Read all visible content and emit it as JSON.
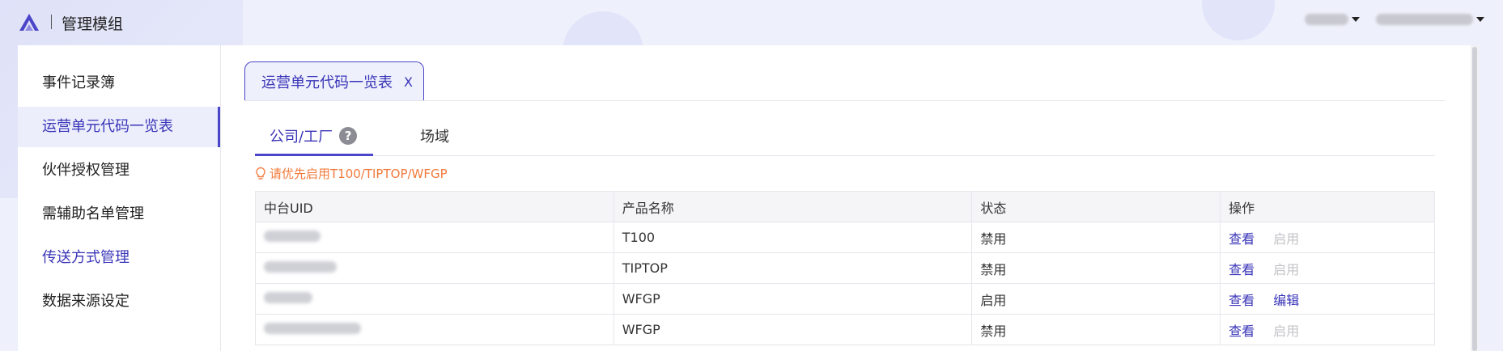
{
  "app": {
    "title": "管理模组"
  },
  "header": {
    "users": [
      {
        "label": "",
        "blur_width": 54
      },
      {
        "label": "",
        "blur_width": 120
      }
    ]
  },
  "sidebar": {
    "items": [
      {
        "label": "事件记录簿",
        "active": false
      },
      {
        "label": "运营单元代码一览表",
        "active": true
      },
      {
        "label": "伙伴授权管理",
        "active": false
      },
      {
        "label": "需辅助名单管理",
        "active": false
      },
      {
        "label": "传送方式管理",
        "active": false
      },
      {
        "label": "数据来源设定",
        "active": false
      }
    ]
  },
  "page_tab": {
    "label": "运营单元代码一览表",
    "close": "X"
  },
  "sub_tabs": [
    {
      "label": "公司/工厂",
      "active": true,
      "help": "?"
    },
    {
      "label": "场域",
      "active": false
    }
  ],
  "notice": "请优先启用T100/TIPTOP/WFGP",
  "table": {
    "columns": [
      "中台UID",
      "产品名称",
      "状态",
      "操作"
    ],
    "rows": [
      {
        "product": "T100",
        "status": "禁用",
        "actions": [
          {
            "label": "查看",
            "enabled": true
          },
          {
            "label": "启用",
            "enabled": false
          }
        ]
      },
      {
        "product": "TIPTOP",
        "status": "禁用",
        "actions": [
          {
            "label": "查看",
            "enabled": true
          },
          {
            "label": "启用",
            "enabled": false
          }
        ]
      },
      {
        "product": "WFGP",
        "status": "启用",
        "actions": [
          {
            "label": "查看",
            "enabled": true
          },
          {
            "label": "编辑",
            "enabled": true
          }
        ]
      },
      {
        "product": "WFGP",
        "status": "禁用",
        "actions": [
          {
            "label": "查看",
            "enabled": true
          },
          {
            "label": "启用",
            "enabled": false
          }
        ]
      }
    ]
  },
  "colors": {
    "accent": "#3a35b8",
    "notice": "#f27a3c",
    "disabled": "#c3c3c8"
  }
}
